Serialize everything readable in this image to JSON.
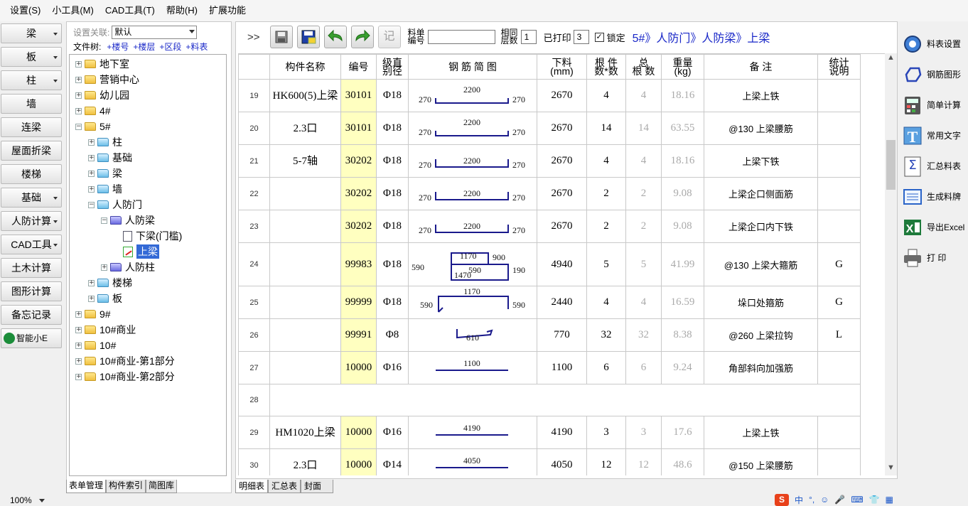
{
  "menubar": [
    "设置(S)",
    "小工具(M)",
    "CAD工具(T)",
    "帮助(H)",
    "扩展功能"
  ],
  "leftbar": [
    {
      "label": "梁",
      "dropdown": true
    },
    {
      "label": "板",
      "dropdown": true
    },
    {
      "label": "柱",
      "dropdown": true
    },
    {
      "label": "墙",
      "dropdown": false
    },
    {
      "label": "连梁",
      "dropdown": false
    },
    {
      "label": "屋面折梁",
      "dropdown": false
    },
    {
      "label": "楼梯",
      "dropdown": false
    },
    {
      "label": "基础",
      "dropdown": true
    },
    {
      "label": "人防计算",
      "dropdown": true
    },
    {
      "label": "CAD工具",
      "dropdown": true
    },
    {
      "label": "土木计算",
      "dropdown": false
    },
    {
      "label": "图形计算",
      "dropdown": false
    },
    {
      "label": "备忘记录",
      "dropdown": false
    },
    {
      "label": "智能小E",
      "dropdown": false
    }
  ],
  "tree_header": {
    "setting_label": "设置关联:",
    "setting_value": "默认",
    "filetree_label": "文件树:",
    "links": [
      "+楼号",
      "+楼层",
      "+区段",
      "+料表"
    ]
  },
  "tree": [
    {
      "label": "地下室",
      "icon": "folder",
      "level": 0,
      "toggle": "+"
    },
    {
      "label": "营销中心",
      "icon": "folder",
      "level": 0,
      "toggle": "+"
    },
    {
      "label": "幼儿园",
      "icon": "folder",
      "level": 0,
      "toggle": "+"
    },
    {
      "label": "4#",
      "icon": "folder",
      "level": 0,
      "toggle": "+"
    },
    {
      "label": "5#",
      "icon": "folder-open",
      "level": 0,
      "toggle": "-"
    },
    {
      "label": "柱",
      "icon": "folder-blue",
      "level": 1,
      "toggle": "+"
    },
    {
      "label": "基础",
      "icon": "folder-blue",
      "level": 1,
      "toggle": "+"
    },
    {
      "label": "梁",
      "icon": "folder-blue",
      "level": 1,
      "toggle": "+"
    },
    {
      "label": "墙",
      "icon": "folder-blue",
      "level": 1,
      "toggle": "+"
    },
    {
      "label": "人防门",
      "icon": "folder-blue",
      "level": 1,
      "toggle": "-"
    },
    {
      "label": "人防梁",
      "icon": "folder-purple",
      "level": 2,
      "toggle": "-"
    },
    {
      "label": "下梁(门槛)",
      "icon": "doc",
      "level": 3,
      "toggle": ""
    },
    {
      "label": "上梁",
      "icon": "doc-edit",
      "level": 3,
      "toggle": "",
      "selected": true
    },
    {
      "label": "人防柱",
      "icon": "folder-purple",
      "level": 2,
      "toggle": "+"
    },
    {
      "label": "楼梯",
      "icon": "folder-blue",
      "level": 1,
      "toggle": "+"
    },
    {
      "label": "板",
      "icon": "folder-blue",
      "level": 1,
      "toggle": "+"
    },
    {
      "label": "9#",
      "icon": "folder",
      "level": 0,
      "toggle": "+"
    },
    {
      "label": "10#商业",
      "icon": "folder",
      "level": 0,
      "toggle": "+"
    },
    {
      "label": "10#",
      "icon": "folder",
      "level": 0,
      "toggle": "+"
    },
    {
      "label": "10#商业-第1部分",
      "icon": "folder",
      "level": 0,
      "toggle": "+"
    },
    {
      "label": "10#商业-第2部分",
      "icon": "folder",
      "level": 0,
      "toggle": "+"
    }
  ],
  "tree_tabs": [
    "表单管理",
    "构件索引",
    "简图库"
  ],
  "toolbar": {
    "nav_glyph": ">>",
    "record_label": "记",
    "sheet_no_label": [
      "料单",
      "编号"
    ],
    "sheet_no_value": "",
    "same_floor_label": [
      "相同",
      "层数"
    ],
    "same_floor_value": "1",
    "printed_label": "已打印",
    "printed_value": "3",
    "lock_label": "锁定",
    "lock_checked": true,
    "breadcrumb": "5#》人防门》人防梁》上梁"
  },
  "grid": {
    "headers": [
      {
        "lines": [
          ""
        ]
      },
      {
        "lines": [
          "构件名称"
        ]
      },
      {
        "lines": [
          "编号"
        ]
      },
      {
        "lines": [
          "级直",
          "别径"
        ]
      },
      {
        "lines": [
          "钢 筋 简 图"
        ]
      },
      {
        "lines": [
          "下料",
          "(mm)"
        ]
      },
      {
        "lines": [
          "根 件",
          "数*数"
        ]
      },
      {
        "lines": [
          "总",
          "根 数"
        ]
      },
      {
        "lines": [
          "重量",
          "(kg)"
        ]
      },
      {
        "lines": [
          "备      注"
        ]
      },
      {
        "lines": [
          "统计",
          "说明"
        ]
      }
    ],
    "rows": [
      {
        "n": "19",
        "name": "HK600(5)上梁",
        "code": "30101",
        "grade": "Φ18",
        "shape": "u",
        "dims": [
          "270",
          "2200",
          "270"
        ],
        "len": "2670",
        "count": "4",
        "total": "4",
        "weight": "18.16",
        "note": "上梁上铁",
        "stat": ""
      },
      {
        "n": "20",
        "name": "2.3口",
        "code": "30101",
        "grade": "Φ18",
        "shape": "u",
        "dims": [
          "270",
          "2200",
          "270"
        ],
        "len": "2670",
        "count": "14",
        "total": "14",
        "weight": "63.55",
        "note": "@130 上梁腰筋",
        "stat": ""
      },
      {
        "n": "21",
        "name": "5-7轴",
        "code": "30202",
        "grade": "Φ18",
        "shape": "n",
        "dims": [
          "270",
          "2200",
          "270"
        ],
        "len": "2670",
        "count": "4",
        "total": "4",
        "weight": "18.16",
        "note": "上梁下铁",
        "stat": ""
      },
      {
        "n": "22",
        "name": "",
        "code": "30202",
        "grade": "Φ18",
        "shape": "n",
        "dims": [
          "270",
          "2200",
          "270"
        ],
        "len": "2670",
        "count": "2",
        "total": "2",
        "weight": "9.08",
        "note": "上梁企口侧面筋",
        "stat": ""
      },
      {
        "n": "23",
        "name": "",
        "code": "30202",
        "grade": "Φ18",
        "shape": "n",
        "dims": [
          "270",
          "2200",
          "270"
        ],
        "len": "2670",
        "count": "2",
        "total": "2",
        "weight": "9.08",
        "note": "上梁企口内下铁",
        "stat": ""
      },
      {
        "n": "24",
        "name": "",
        "code": "99983",
        "grade": "Φ18",
        "shape": "hoop2",
        "dims": [
          "1170",
          "900",
          "590",
          "1470",
          "590",
          "190"
        ],
        "len": "4940",
        "count": "5",
        "total": "5",
        "weight": "41.99",
        "note": "@130 上梁大箍筋",
        "stat": "G"
      },
      {
        "n": "25",
        "name": "",
        "code": "99999",
        "grade": "Φ18",
        "shape": "open-hoop",
        "dims": [
          "1170",
          "590",
          "590"
        ],
        "len": "2440",
        "count": "4",
        "total": "4",
        "weight": "16.59",
        "note": "垛口处箍筋",
        "stat": "G"
      },
      {
        "n": "26",
        "name": "",
        "code": "99991",
        "grade": "Φ8",
        "shape": "tie",
        "dims": [
          "610"
        ],
        "len": "770",
        "count": "32",
        "total": "32",
        "weight": "8.38",
        "note": "@260 上梁拉钩",
        "stat": "L"
      },
      {
        "n": "27",
        "name": "",
        "code": "10000",
        "grade": "Φ16",
        "shape": "line",
        "dims": [
          "1100"
        ],
        "len": "1100",
        "count": "6",
        "total": "6",
        "weight": "9.24",
        "note": "角部斜向加强筋",
        "stat": ""
      },
      {
        "n": "28",
        "empty": true
      },
      {
        "n": "29",
        "name": "HM1020上梁",
        "code": "10000",
        "grade": "Φ16",
        "shape": "line",
        "dims": [
          "4190"
        ],
        "len": "4190",
        "count": "3",
        "total": "3",
        "weight": "17.6",
        "note": "上梁上铁",
        "stat": ""
      },
      {
        "n": "30",
        "name": "2.3口",
        "code": "10000",
        "grade": "Φ14",
        "shape": "line",
        "dims": [
          "4050"
        ],
        "len": "4050",
        "count": "12",
        "total": "12",
        "weight": "48.6",
        "note": "@150 上梁腰筋",
        "stat": ""
      }
    ]
  },
  "main_tabs": [
    "明细表",
    "汇总表",
    "封面"
  ],
  "rightbar": [
    {
      "label": "料表设置",
      "icon": "gear-icon"
    },
    {
      "label": "钢筋图形",
      "icon": "rebar-shape-icon"
    },
    {
      "label": "简单计算",
      "icon": "calculator-icon"
    },
    {
      "label": "常用文字",
      "icon": "text-icon"
    },
    {
      "label": "汇总料表",
      "icon": "sigma-icon"
    },
    {
      "label": "生成料牌",
      "icon": "card-icon"
    },
    {
      "label": "导出Excel",
      "icon": "excel-icon"
    },
    {
      "label": "打 印",
      "icon": "printer-icon"
    }
  ],
  "status": {
    "zoom": "100%",
    "ime_glyphs": [
      "S",
      "中",
      "°,",
      "☺",
      "🎤",
      "⌨",
      "👕",
      "▦"
    ]
  },
  "colors": {
    "accent": "#1a28c8",
    "code_bg": "#ffffc0",
    "rebar": "#1a1a8c",
    "selected": "#3369d6"
  }
}
